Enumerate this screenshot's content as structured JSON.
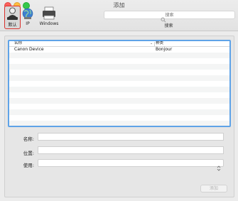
{
  "window": {
    "title": "添加"
  },
  "toolbar": {
    "tools": [
      {
        "label": "默认",
        "icon": "default-printer-icon",
        "selected": true
      },
      {
        "label": "IP",
        "icon": "ip-globe-icon",
        "selected": false
      },
      {
        "label": "Windows",
        "icon": "windows-printer-icon",
        "selected": false
      }
    ],
    "search": {
      "placeholder": "搜索",
      "caption": "搜索"
    },
    "selected_outline_color": "#d9302c"
  },
  "printer_list": {
    "columns": {
      "name": "名称",
      "kind": "种类"
    },
    "rows": [
      {
        "name": "Canon Device",
        "kind": "Bonjour"
      }
    ],
    "focus_color": "#5fa3e8"
  },
  "form": {
    "name_label": "名称:",
    "location_label": "位置:",
    "use_label": "使用:",
    "name_value": "",
    "location_value": "",
    "use_value": ""
  },
  "footer": {
    "add_label": "添加"
  }
}
